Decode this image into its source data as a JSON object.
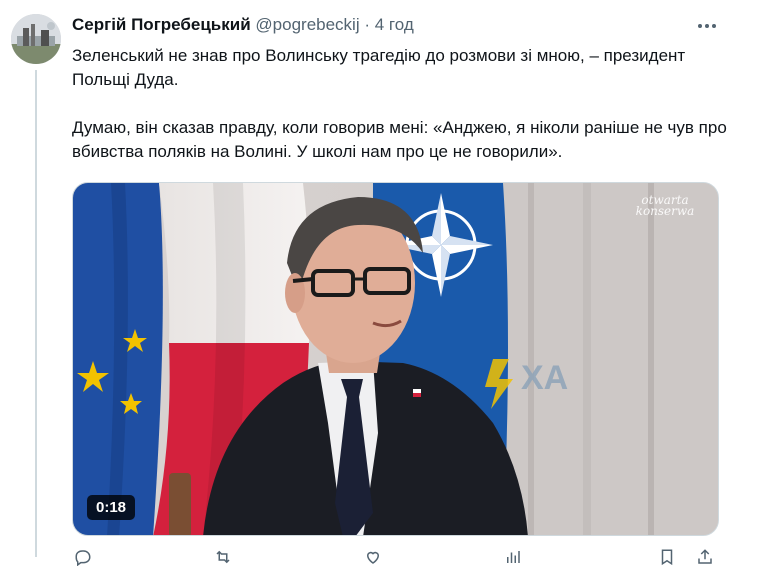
{
  "tweet": {
    "author_name": "Сергій Погребецький",
    "handle": "@pogrebeckij",
    "separator": "·",
    "time": "4 год",
    "paragraphs": [
      "Зеленський не знав про Волинську трагедію до розмови зі мною, – президент Польщі Дуда.",
      "Думаю, він сказав правду, коли говорив мені: «Анджею, я ніколи раніше не чув про вбивства поляків на Волині. У школі нам про це не говорили»."
    ]
  },
  "media": {
    "type": "video",
    "duration": "0:18",
    "watermark_line1": "otwarta",
    "watermark_line2": "konserwa",
    "overlay_logo": "ХА"
  },
  "actions": {
    "reply_count": "",
    "retweet_count": "",
    "like_count": "",
    "views_count": "",
    "icons": [
      "reply-icon",
      "retweet-icon",
      "like-icon",
      "views-icon",
      "bookmark-icon",
      "share-icon"
    ]
  },
  "colors": {
    "text_primary": "#0f1419",
    "text_secondary": "#536471",
    "border": "#cfd9de",
    "eu_blue": "#1f4fa3",
    "eu_star": "#f2c200",
    "poland_red": "#d4213d",
    "nato_blue": "#1a5aab"
  }
}
